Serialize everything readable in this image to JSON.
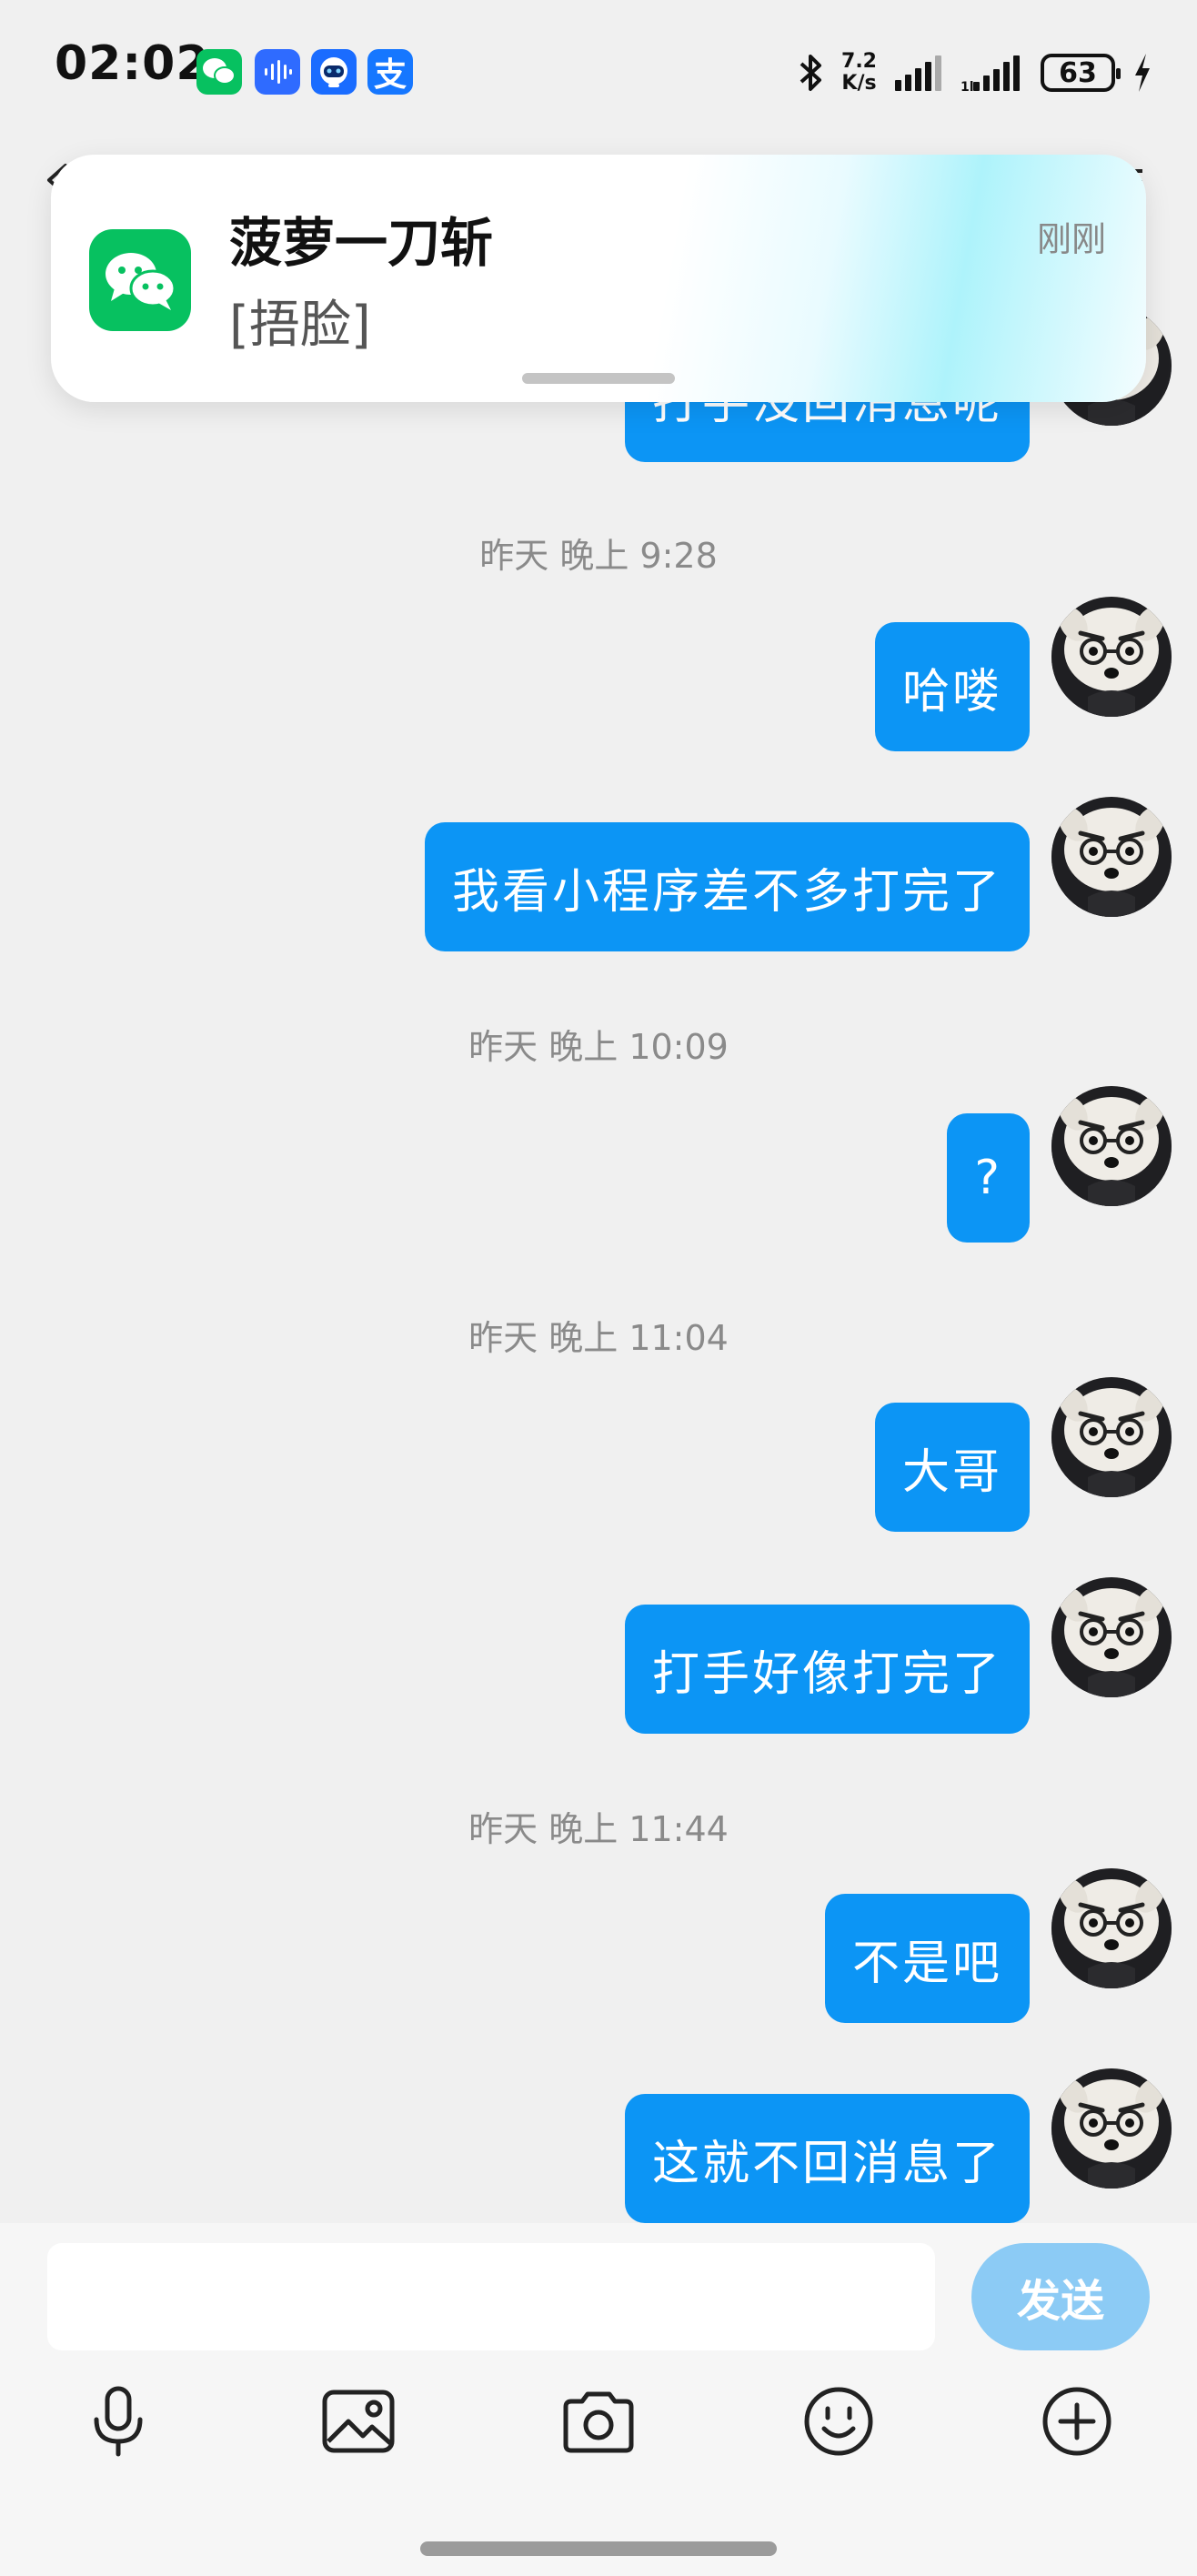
{
  "status_bar": {
    "time": "02:02",
    "net_speed_value": "7.2",
    "net_speed_unit": "K/s",
    "battery": "63",
    "app_icons": [
      "wechat-icon",
      "voice-assistant-icon",
      "bot-icon",
      "alipay-icon"
    ],
    "alipay_glyph": "支"
  },
  "notification": {
    "app": "wechat",
    "title": "菠萝一刀斩",
    "body": "[捂脸]",
    "time": "刚刚"
  },
  "chat": {
    "partial_message": "打手没回消息呢",
    "timestamps": [
      "昨天 晚上 9:28",
      "昨天 晚上 10:09",
      "昨天 晚上 11:04",
      "昨天 晚上 11:44"
    ],
    "messages": [
      "哈喽",
      "我看小程序差不多打完了",
      "?",
      "大哥",
      "打手好像打完了",
      "不是吧",
      "这就不回消息了"
    ]
  },
  "input": {
    "value": "",
    "send_label": "发送"
  },
  "toolbar": [
    "mic-icon",
    "image-icon",
    "camera-icon",
    "emoji-icon",
    "plus-icon"
  ],
  "colors": {
    "bubble": "#0c95f5",
    "send_disabled": "#8ccbf5",
    "background": "#f0f0f0",
    "wechat_green": "#07c160"
  }
}
